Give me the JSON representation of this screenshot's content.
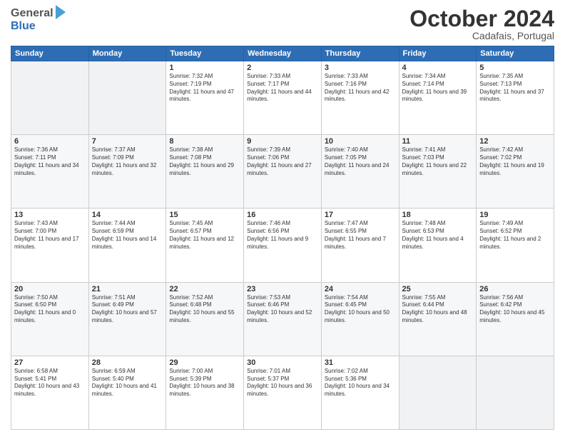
{
  "header": {
    "logo_general": "General",
    "logo_blue": "Blue",
    "month": "October 2024",
    "location": "Cadafais, Portugal"
  },
  "days_of_week": [
    "Sunday",
    "Monday",
    "Tuesday",
    "Wednesday",
    "Thursday",
    "Friday",
    "Saturday"
  ],
  "weeks": [
    [
      {
        "day": "",
        "sunrise": "",
        "sunset": "",
        "daylight": ""
      },
      {
        "day": "",
        "sunrise": "",
        "sunset": "",
        "daylight": ""
      },
      {
        "day": "1",
        "sunrise": "Sunrise: 7:32 AM",
        "sunset": "Sunset: 7:19 PM",
        "daylight": "Daylight: 11 hours and 47 minutes."
      },
      {
        "day": "2",
        "sunrise": "Sunrise: 7:33 AM",
        "sunset": "Sunset: 7:17 PM",
        "daylight": "Daylight: 11 hours and 44 minutes."
      },
      {
        "day": "3",
        "sunrise": "Sunrise: 7:33 AM",
        "sunset": "Sunset: 7:16 PM",
        "daylight": "Daylight: 11 hours and 42 minutes."
      },
      {
        "day": "4",
        "sunrise": "Sunrise: 7:34 AM",
        "sunset": "Sunset: 7:14 PM",
        "daylight": "Daylight: 11 hours and 39 minutes."
      },
      {
        "day": "5",
        "sunrise": "Sunrise: 7:35 AM",
        "sunset": "Sunset: 7:13 PM",
        "daylight": "Daylight: 11 hours and 37 minutes."
      }
    ],
    [
      {
        "day": "6",
        "sunrise": "Sunrise: 7:36 AM",
        "sunset": "Sunset: 7:11 PM",
        "daylight": "Daylight: 11 hours and 34 minutes."
      },
      {
        "day": "7",
        "sunrise": "Sunrise: 7:37 AM",
        "sunset": "Sunset: 7:09 PM",
        "daylight": "Daylight: 11 hours and 32 minutes."
      },
      {
        "day": "8",
        "sunrise": "Sunrise: 7:38 AM",
        "sunset": "Sunset: 7:08 PM",
        "daylight": "Daylight: 11 hours and 29 minutes."
      },
      {
        "day": "9",
        "sunrise": "Sunrise: 7:39 AM",
        "sunset": "Sunset: 7:06 PM",
        "daylight": "Daylight: 11 hours and 27 minutes."
      },
      {
        "day": "10",
        "sunrise": "Sunrise: 7:40 AM",
        "sunset": "Sunset: 7:05 PM",
        "daylight": "Daylight: 11 hours and 24 minutes."
      },
      {
        "day": "11",
        "sunrise": "Sunrise: 7:41 AM",
        "sunset": "Sunset: 7:03 PM",
        "daylight": "Daylight: 11 hours and 22 minutes."
      },
      {
        "day": "12",
        "sunrise": "Sunrise: 7:42 AM",
        "sunset": "Sunset: 7:02 PM",
        "daylight": "Daylight: 11 hours and 19 minutes."
      }
    ],
    [
      {
        "day": "13",
        "sunrise": "Sunrise: 7:43 AM",
        "sunset": "Sunset: 7:00 PM",
        "daylight": "Daylight: 11 hours and 17 minutes."
      },
      {
        "day": "14",
        "sunrise": "Sunrise: 7:44 AM",
        "sunset": "Sunset: 6:59 PM",
        "daylight": "Daylight: 11 hours and 14 minutes."
      },
      {
        "day": "15",
        "sunrise": "Sunrise: 7:45 AM",
        "sunset": "Sunset: 6:57 PM",
        "daylight": "Daylight: 11 hours and 12 minutes."
      },
      {
        "day": "16",
        "sunrise": "Sunrise: 7:46 AM",
        "sunset": "Sunset: 6:56 PM",
        "daylight": "Daylight: 11 hours and 9 minutes."
      },
      {
        "day": "17",
        "sunrise": "Sunrise: 7:47 AM",
        "sunset": "Sunset: 6:55 PM",
        "daylight": "Daylight: 11 hours and 7 minutes."
      },
      {
        "day": "18",
        "sunrise": "Sunrise: 7:48 AM",
        "sunset": "Sunset: 6:53 PM",
        "daylight": "Daylight: 11 hours and 4 minutes."
      },
      {
        "day": "19",
        "sunrise": "Sunrise: 7:49 AM",
        "sunset": "Sunset: 6:52 PM",
        "daylight": "Daylight: 11 hours and 2 minutes."
      }
    ],
    [
      {
        "day": "20",
        "sunrise": "Sunrise: 7:50 AM",
        "sunset": "Sunset: 6:50 PM",
        "daylight": "Daylight: 11 hours and 0 minutes."
      },
      {
        "day": "21",
        "sunrise": "Sunrise: 7:51 AM",
        "sunset": "Sunset: 6:49 PM",
        "daylight": "Daylight: 10 hours and 57 minutes."
      },
      {
        "day": "22",
        "sunrise": "Sunrise: 7:52 AM",
        "sunset": "Sunset: 6:48 PM",
        "daylight": "Daylight: 10 hours and 55 minutes."
      },
      {
        "day": "23",
        "sunrise": "Sunrise: 7:53 AM",
        "sunset": "Sunset: 6:46 PM",
        "daylight": "Daylight: 10 hours and 52 minutes."
      },
      {
        "day": "24",
        "sunrise": "Sunrise: 7:54 AM",
        "sunset": "Sunset: 6:45 PM",
        "daylight": "Daylight: 10 hours and 50 minutes."
      },
      {
        "day": "25",
        "sunrise": "Sunrise: 7:55 AM",
        "sunset": "Sunset: 6:44 PM",
        "daylight": "Daylight: 10 hours and 48 minutes."
      },
      {
        "day": "26",
        "sunrise": "Sunrise: 7:56 AM",
        "sunset": "Sunset: 6:42 PM",
        "daylight": "Daylight: 10 hours and 45 minutes."
      }
    ],
    [
      {
        "day": "27",
        "sunrise": "Sunrise: 6:58 AM",
        "sunset": "Sunset: 5:41 PM",
        "daylight": "Daylight: 10 hours and 43 minutes."
      },
      {
        "day": "28",
        "sunrise": "Sunrise: 6:59 AM",
        "sunset": "Sunset: 5:40 PM",
        "daylight": "Daylight: 10 hours and 41 minutes."
      },
      {
        "day": "29",
        "sunrise": "Sunrise: 7:00 AM",
        "sunset": "Sunset: 5:39 PM",
        "daylight": "Daylight: 10 hours and 38 minutes."
      },
      {
        "day": "30",
        "sunrise": "Sunrise: 7:01 AM",
        "sunset": "Sunset: 5:37 PM",
        "daylight": "Daylight: 10 hours and 36 minutes."
      },
      {
        "day": "31",
        "sunrise": "Sunrise: 7:02 AM",
        "sunset": "Sunset: 5:36 PM",
        "daylight": "Daylight: 10 hours and 34 minutes."
      },
      {
        "day": "",
        "sunrise": "",
        "sunset": "",
        "daylight": ""
      },
      {
        "day": "",
        "sunrise": "",
        "sunset": "",
        "daylight": ""
      }
    ]
  ]
}
